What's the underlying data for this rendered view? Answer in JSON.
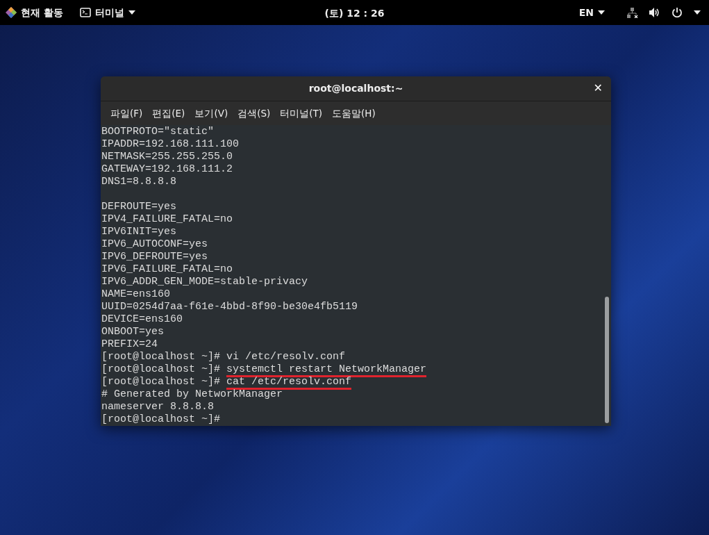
{
  "top_bar": {
    "activities": "현재 활동",
    "app_menu": "터미널",
    "clock": "(토) 12 : 26",
    "language": "EN"
  },
  "window": {
    "title": "root@localhost:~",
    "close": "✕"
  },
  "menu": [
    "파일(F)",
    "편집(E)",
    "보기(V)",
    "검색(S)",
    "터미널(T)",
    "도움말(H)"
  ],
  "terminal_lines": [
    {
      "kind": "output",
      "text": "BOOTPROTO=\"static\""
    },
    {
      "kind": "output",
      "text": "IPADDR=192.168.111.100"
    },
    {
      "kind": "output",
      "text": "NETMASK=255.255.255.0"
    },
    {
      "kind": "output",
      "text": "GATEWAY=192.168.111.2"
    },
    {
      "kind": "output",
      "text": "DNS1=8.8.8.8"
    },
    {
      "kind": "blank"
    },
    {
      "kind": "output",
      "text": "DEFROUTE=yes"
    },
    {
      "kind": "output",
      "text": "IPV4_FAILURE_FATAL=no"
    },
    {
      "kind": "output",
      "text": "IPV6INIT=yes"
    },
    {
      "kind": "output",
      "text": "IPV6_AUTOCONF=yes"
    },
    {
      "kind": "output",
      "text": "IPV6_DEFROUTE=yes"
    },
    {
      "kind": "output",
      "text": "IPV6_FAILURE_FATAL=no"
    },
    {
      "kind": "output",
      "text": "IPV6_ADDR_GEN_MODE=stable-privacy"
    },
    {
      "kind": "output",
      "text": "NAME=ens160"
    },
    {
      "kind": "output",
      "text": "UUID=0254d7aa-f61e-4bbd-8f90-be30e4fb5119"
    },
    {
      "kind": "output",
      "text": "DEVICE=ens160"
    },
    {
      "kind": "output",
      "text": "ONBOOT=yes"
    },
    {
      "kind": "output",
      "text": "PREFIX=24"
    },
    {
      "kind": "prompt",
      "prompt": "[root@localhost ~]#",
      "command": "vi /etc/resolv.conf",
      "underlined": false
    },
    {
      "kind": "prompt",
      "prompt": "[root@localhost ~]#",
      "command": "systemctl restart NetworkManager",
      "underlined": true
    },
    {
      "kind": "prompt",
      "prompt": "[root@localhost ~]#",
      "command": "cat /etc/resolv.conf",
      "underlined": true
    },
    {
      "kind": "output",
      "text": "# Generated by NetworkManager"
    },
    {
      "kind": "output",
      "text": "nameserver 8.8.8.8"
    },
    {
      "kind": "prompt",
      "prompt": "[root@localhost ~]#"
    }
  ]
}
